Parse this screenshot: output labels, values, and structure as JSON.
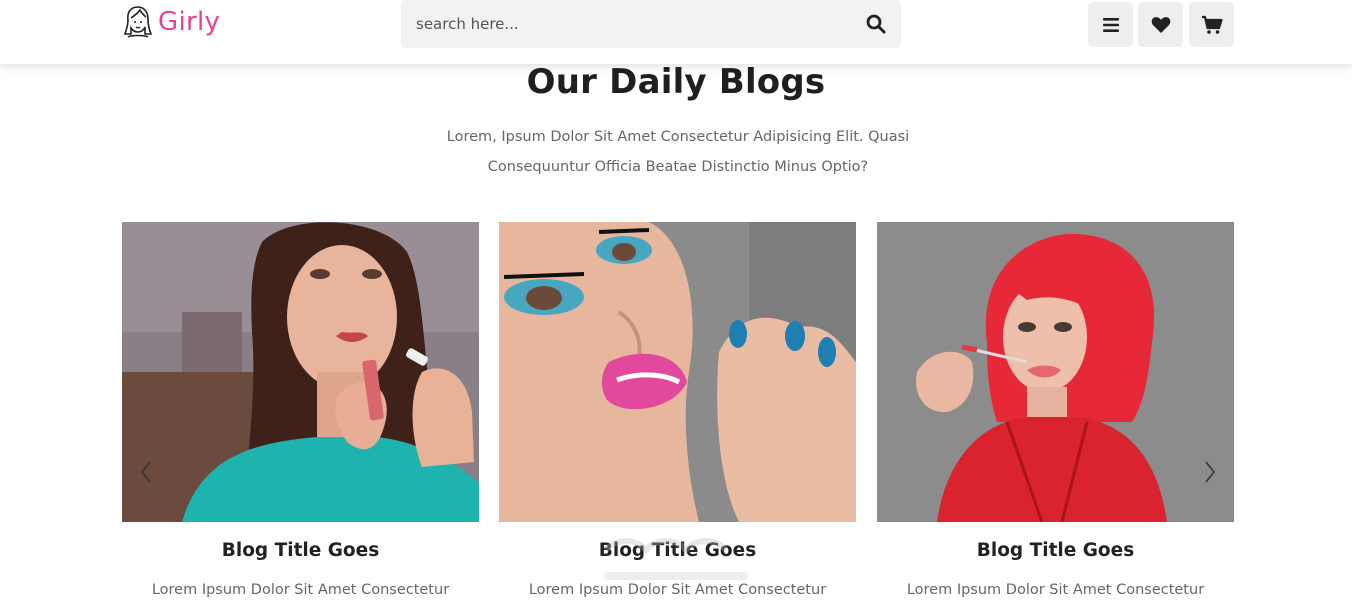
{
  "header": {
    "logo_text": "Girly",
    "search_placeholder": "search here...",
    "icons": [
      "search-icon",
      "menu-icon",
      "heart-icon",
      "cart-icon"
    ]
  },
  "section": {
    "title": "Our Daily Blogs",
    "subtitle": "Lorem, Ipsum Dolor Sit Amet Consectetur Adipisicing Elit. Quasi Consequuntur Officia Beatae Distinctio Minus Optio?"
  },
  "blogs": [
    {
      "title": "Blog Title Goes",
      "text": "Lorem Ipsum Dolor Sit Amet Consectetur"
    },
    {
      "title": "Blog Title Goes",
      "text": "Lorem Ipsum Dolor Sit Amet Consectetur"
    },
    {
      "title": "Blog Title Goes",
      "text": "Lorem Ipsum Dolor Sit Amet Consectetur"
    }
  ],
  "colors": {
    "brand": "#e84393",
    "heading": "#1f1f1f",
    "muted_text": "#666666",
    "button_bg": "#eeeeee",
    "search_bg": "#f2f2f2"
  }
}
